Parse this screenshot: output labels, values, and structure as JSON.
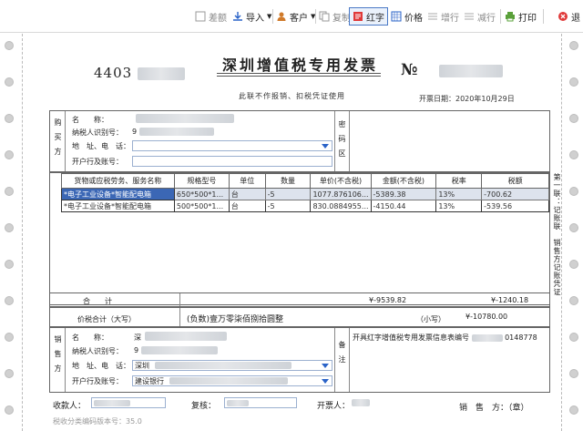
{
  "toolbar": {
    "items": [
      {
        "label": "差额"
      },
      {
        "label": "导入"
      },
      {
        "label": "客户"
      },
      {
        "label": "复制"
      },
      {
        "label": "红字"
      },
      {
        "label": "价格"
      },
      {
        "label": "增行"
      },
      {
        "label": "减行"
      },
      {
        "label": "打印"
      },
      {
        "label": "退"
      }
    ]
  },
  "invoice": {
    "code_prefix": "4403",
    "title": "深圳增值税专用发票",
    "no_label": "№",
    "copy_note": "此联不作报销、扣税凭证使用",
    "issue_date_label": "开票日期：",
    "issue_date": "2020年10月29日",
    "buyer_section": "购买方",
    "buyer_name_label": "名　　称：",
    "buyer_taxid_label": "纳税人识别号：",
    "buyer_taxid_prefix": "9",
    "buyer_addr_label": "地　址、电　话：",
    "buyer_bank_label": "开户行及账号：",
    "password_section": "密码区",
    "side_copy": "第一联：记账联　销售方记账凭证",
    "columns": [
      "货物或应税劳务、服务名称",
      "规格型号",
      "单位",
      "数量",
      "单价(不含税)",
      "金额(不含税)",
      "税率",
      "税额"
    ],
    "rows": [
      {
        "name": "*电子工业设备*智能配电箱",
        "spec": "650*500*1...",
        "unit": "台",
        "qty": "-5",
        "price": "1077.876106...",
        "amount": "-5389.38",
        "rate": "13%",
        "tax": "-700.62"
      },
      {
        "name": "*电子工业设备*智能配电箱",
        "spec": "500*500*1...",
        "unit": "台",
        "qty": "-5",
        "price": "830.0884955...",
        "amount": "-4150.44",
        "rate": "13%",
        "tax": "-539.56"
      }
    ],
    "total_label": "合　　计",
    "total_amount": "¥-9539.82",
    "total_tax": "¥-1240.18",
    "grand_label": "价税合计（大写）",
    "grand_upper": "(负数)壹万零柒佰捌拾圆整",
    "grand_lower_label": "（小写）",
    "grand_lower": "¥-10780.00",
    "seller_section": "销售方",
    "seller_name_label": "名　　称：",
    "seller_name_prefix": "深",
    "seller_taxid_label": "纳税人识别号：",
    "seller_taxid_prefix": "9",
    "seller_addr_label": "地　址、电　话：",
    "seller_addr_prefix": "深圳",
    "seller_bank_label": "开户行及账号：",
    "seller_bank_prefix": "建设银行",
    "remark_section": "备注",
    "remark_prefix": "开具红字增值税专用发票信息表编号",
    "remark_suffix": "0148778",
    "payee_label": "收款人：",
    "reviewer_label": "复核：",
    "drawer_label": "开票人：",
    "seller_seal_label": "销　售　方：（章）",
    "version": "税收分类编码版本号：35.0"
  }
}
